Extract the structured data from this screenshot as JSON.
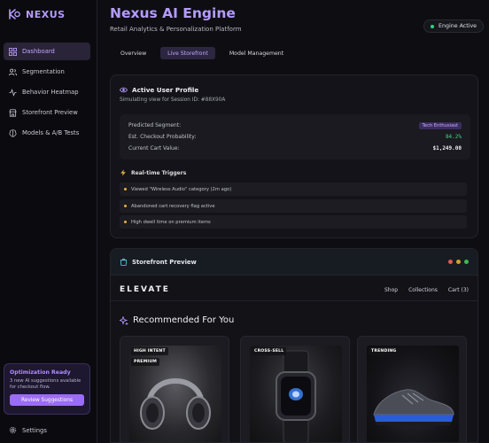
{
  "app": {
    "name": "NEXUS",
    "title": "Nexus AI Engine",
    "subtitle": "Retail Analytics & Personalization Platform",
    "status": "Engine Active"
  },
  "sidebar": {
    "items": [
      {
        "label": "Dashboard",
        "icon": "grid-icon",
        "active": true
      },
      {
        "label": "Segmentation",
        "icon": "users-icon",
        "active": false
      },
      {
        "label": "Behavior Heatmap",
        "icon": "activity-icon",
        "active": false
      },
      {
        "label": "Storefront Preview",
        "icon": "store-icon",
        "active": false
      },
      {
        "label": "Models & A/B Tests",
        "icon": "brain-icon",
        "active": false
      }
    ],
    "promo": {
      "title": "Optimization Ready",
      "text": "3 new AI suggestions available for checkout flow.",
      "button": "Review Suggestions"
    },
    "settings": "Settings"
  },
  "tabs": [
    {
      "label": "Overview",
      "active": false
    },
    {
      "label": "Live Storefront",
      "active": true
    },
    {
      "label": "Model Management",
      "active": false
    }
  ],
  "profile": {
    "title": "Active User Profile",
    "session": "Simulating view for Session ID: #88X90A",
    "segment_label": "Predicted Segment:",
    "segment_value": "Tech Enthusiast",
    "prob_label": "Est. Checkout Probability:",
    "prob_value": "84.2%",
    "cart_label": "Current Cart Value:",
    "cart_value": "$1,249.00",
    "triggers_title": "Real-time Triggers",
    "triggers": [
      "Viewed \"Wireless Audio\" category (2m ago)",
      "Abandoned cart recovery flag active",
      "High dwell time on premium items"
    ]
  },
  "storefront": {
    "title": "Storefront Preview",
    "brand": "ELEVATE",
    "nav": [
      "Shop",
      "Collections",
      "Cart (3)"
    ],
    "recommended": "Recommended For You",
    "products": [
      {
        "badges": [
          "HIGH INTENT",
          "PREMIUM"
        ]
      },
      {
        "badges": [
          "CROSS-SELL"
        ]
      },
      {
        "badges": [
          "TRENDING"
        ]
      }
    ]
  },
  "colors": {
    "accent": "#9b6cf5",
    "success": "#34d27a",
    "warning": "#e3b341",
    "background": "#0e0e12"
  }
}
